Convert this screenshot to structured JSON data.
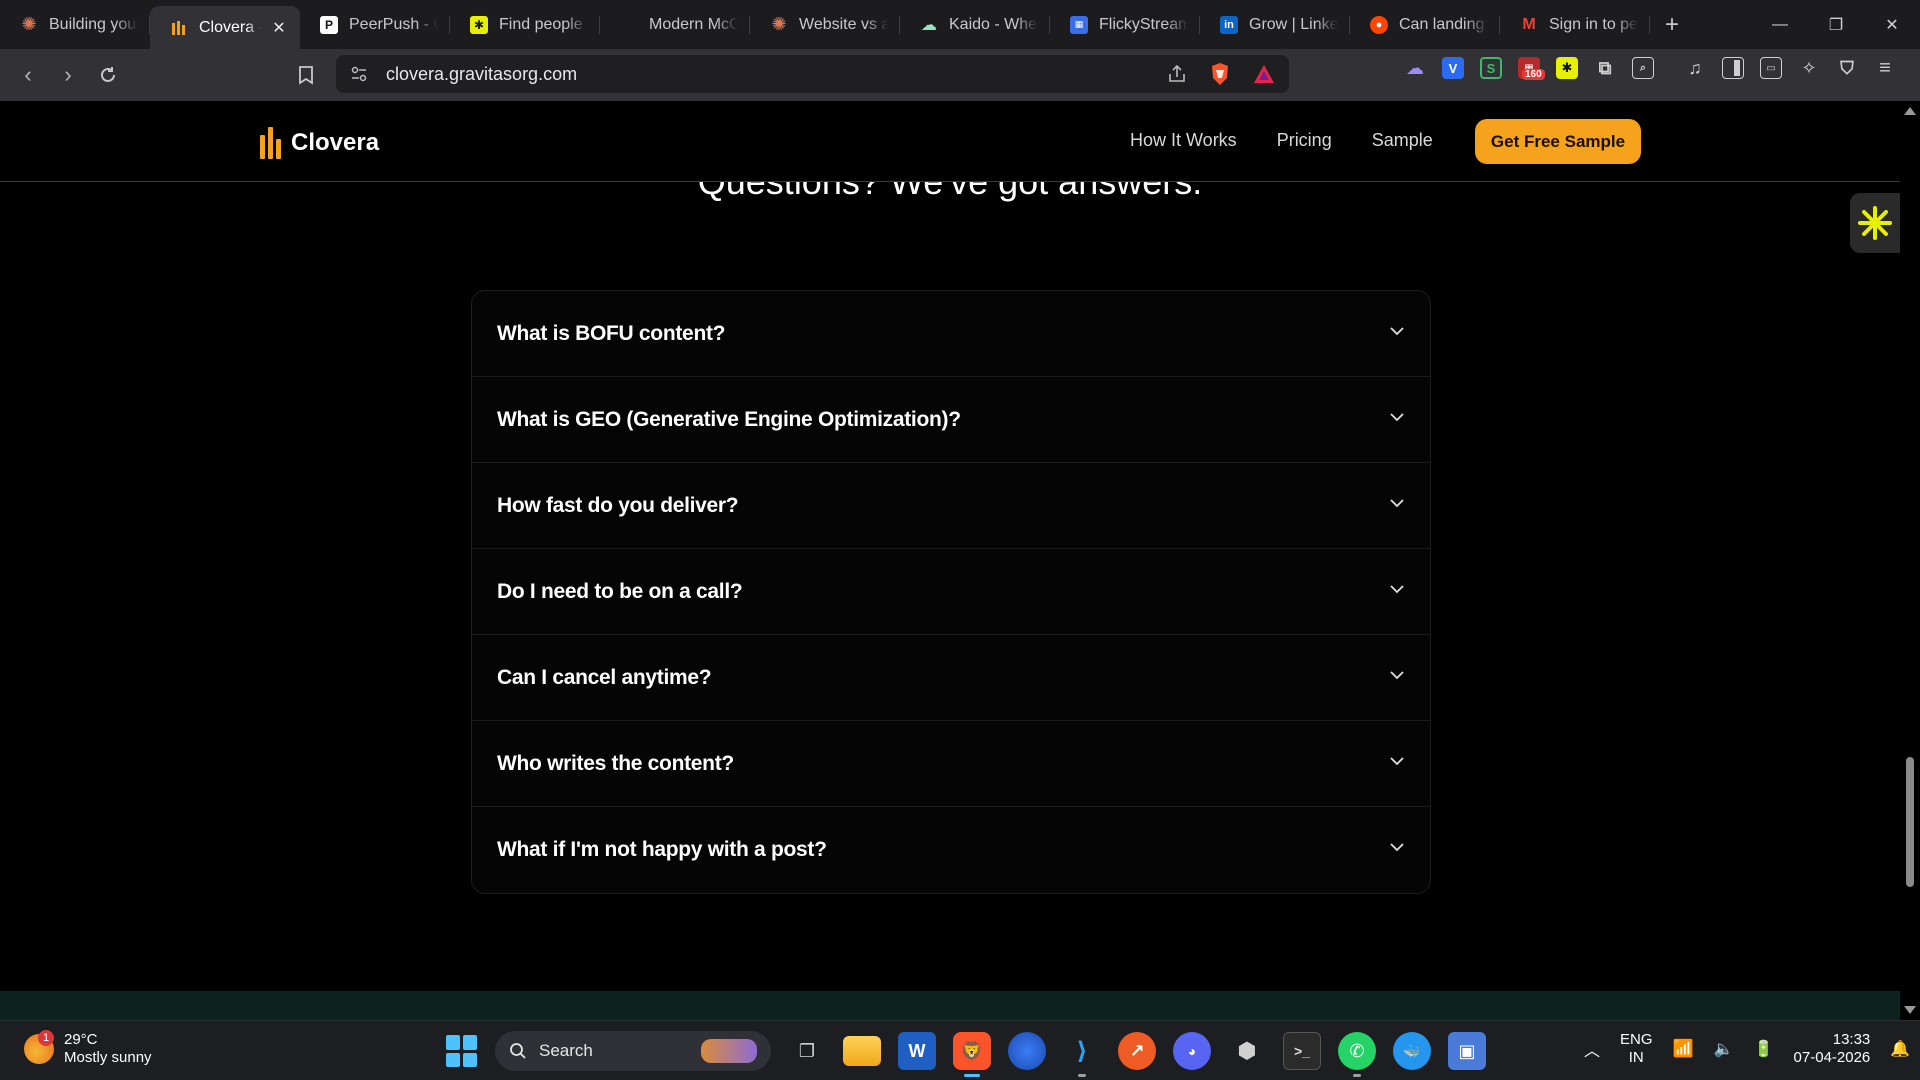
{
  "browser": {
    "tabs": [
      {
        "label": "Building your",
        "icon": "claude-icon",
        "color": "#d97757",
        "active": false
      },
      {
        "label": "Clovera -",
        "icon": "clovera-icon",
        "color": "#f4a020",
        "active": true
      },
      {
        "label": "PeerPush - Gr",
        "icon": "peerpush-icon",
        "color": "#ffffff",
        "active": false
      },
      {
        "label": "Find people -",
        "icon": "asterisk-icon",
        "color": "#e6f000",
        "active": false
      },
      {
        "label": "Modern McG",
        "icon": "blank-page-icon",
        "color": "#1c1c1f",
        "active": false
      },
      {
        "label": "Website vs au",
        "icon": "claude-icon",
        "color": "#d97757",
        "active": false
      },
      {
        "label": "Kaido - Wher",
        "icon": "kaido-icon",
        "color": "#9be0c0",
        "active": false
      },
      {
        "label": "FlickyStream",
        "icon": "flickystream-icon",
        "color": "#3a6ee8",
        "active": false
      },
      {
        "label": "Grow | Linked",
        "icon": "linkedin-icon",
        "color": "#0a66c2",
        "active": false
      },
      {
        "label": "Can landing p",
        "icon": "reddit-icon",
        "color": "#ff4500",
        "active": false
      },
      {
        "label": "Sign in to pe",
        "icon": "gmail-icon",
        "color": "#ea4335",
        "active": false
      }
    ],
    "url": "clovera.gravitasorg.com",
    "extension_badge": "160"
  },
  "site": {
    "logo_text": "Clovera",
    "nav": [
      "How It Works",
      "Pricing",
      "Sample"
    ],
    "cta_label": "Get Free Sample"
  },
  "faq": {
    "heading": "Questions? We've got answers.",
    "items": [
      "What is BOFU content?",
      "What is GEO (Generative Engine Optimization)?",
      "How fast do you deliver?",
      "Do I need to be on a call?",
      "Can I cancel anytime?",
      "Who writes the content?",
      "What if I'm not happy with a post?"
    ]
  },
  "taskbar": {
    "temperature": "29°C",
    "condition": "Mostly sunny",
    "weather_badge": "1",
    "search_placeholder": "Search",
    "lang_top": "ENG",
    "lang_bottom": "IN",
    "time": "13:33",
    "date": "07-04-2026"
  },
  "colors": {
    "accent": "#f5a21d",
    "page_bg": "#000000",
    "footer_strip": "#0c2320"
  }
}
